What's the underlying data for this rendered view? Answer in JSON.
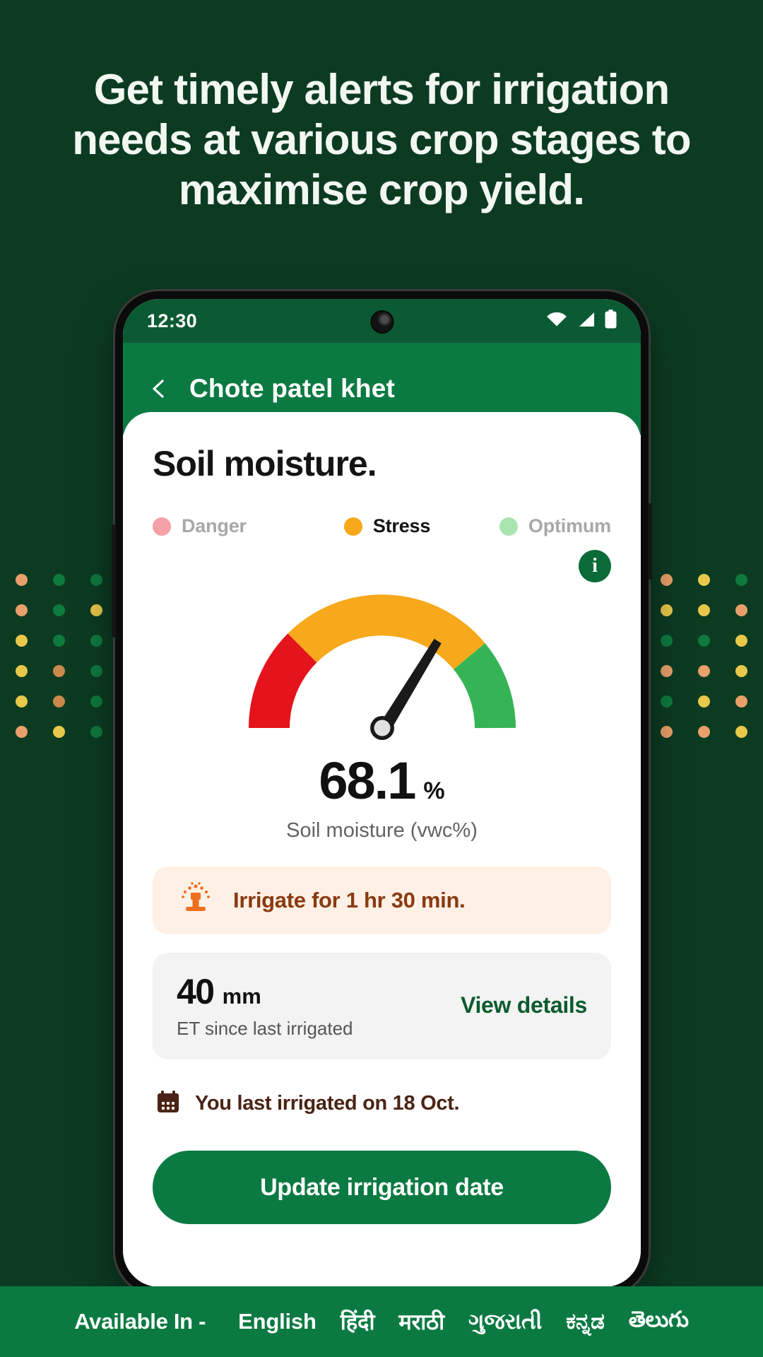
{
  "promo": {
    "headline": "Get timely alerts for irrigation needs at various crop stages to maximise crop yield.",
    "background_color": "#0C3B22"
  },
  "decor": {
    "dot_colors_left": [
      "#E8A06A",
      "#0E7A3E",
      "#0E7A3E",
      "#E8A06A",
      "#0E7A3E",
      "#E8C84A",
      "#E8C84A",
      "#0E7A3E",
      "#0E7A3E",
      "#E8C84A",
      "#C98A4B",
      "#0E7A3E",
      "#E8C84A",
      "#C98A4B",
      "#0E7A3E",
      "#E8A06A",
      "#E8C84A",
      "#0E7A3E"
    ],
    "dot_colors_right": [
      "#E8A06A",
      "#E8C84A",
      "#0E7A3E",
      "#E8C84A",
      "#E8C84A",
      "#E8A06A",
      "#0E7A3E",
      "#0E7A3E",
      "#E8C84A",
      "#E8A06A",
      "#E8A06A",
      "#E8C84A",
      "#0E7A3E",
      "#E8C84A",
      "#E8A06A",
      "#E8A06A",
      "#E8A06A",
      "#E8C84A"
    ]
  },
  "phone": {
    "statusbar": {
      "time": "12:30",
      "wifi_icon": "wifi-icon",
      "signal_icon": "signal-icon",
      "battery_icon": "battery-icon"
    },
    "appbar": {
      "back_icon": "back-chevron-icon",
      "title": "Chote patel khet",
      "background_color": "#0B7A42"
    },
    "screen": {
      "card_title": "Soil moisture.",
      "legend": [
        {
          "label": "Danger",
          "color": "#F5A0A6",
          "state": "dim"
        },
        {
          "label": "Stress",
          "color": "#F7A81B",
          "state": "active"
        },
        {
          "label": "Optimum",
          "color": "#A9E4B0",
          "state": "dim"
        }
      ],
      "info_icon": "info-icon",
      "info_icon_color": "#0B6B38",
      "reading": {
        "value": "68.1",
        "unit": "%",
        "caption": "Soil moisture (vwc%)"
      },
      "irrigate_banner": {
        "icon": "sprinkler-icon",
        "text": "Irrigate for 1 hr 30 min.",
        "background_color": "#FEF0E5",
        "text_color": "#8A3A10"
      },
      "et_panel": {
        "value": "40",
        "unit": "mm",
        "caption": "ET since last irrigated",
        "link_label": "View details",
        "link_color": "#0B5B2E",
        "background_color": "#F3F3F3"
      },
      "last_irrigated": {
        "icon": "calendar-icon",
        "text": "You last irrigated on 18 Oct."
      },
      "cta_label": "Update irrigation date"
    }
  },
  "chart_data": {
    "type": "gauge",
    "title": "Soil moisture.",
    "value": 68.1,
    "unit": "%",
    "ylabel": "Soil moisture (vwc%)",
    "min": 0,
    "max": 100,
    "needle_value": 68.1,
    "bands": [
      {
        "name": "Danger",
        "from": 0,
        "to": 25,
        "color": "#E5131B"
      },
      {
        "name": "Stress",
        "from": 25,
        "to": 78,
        "color": "#F7A81B"
      },
      {
        "name": "Optimum",
        "from": 78,
        "to": 100,
        "color": "#35B455"
      }
    ],
    "legend": [
      "Danger",
      "Stress",
      "Optimum"
    ],
    "legend_position": "top",
    "grid": false
  },
  "languages": {
    "lead_label": "Available In -",
    "items": [
      "English",
      "हिंदी",
      "मराठी",
      "ગુજરાતી",
      "ಕನ್ನಡ",
      "తెలుగు"
    ]
  }
}
